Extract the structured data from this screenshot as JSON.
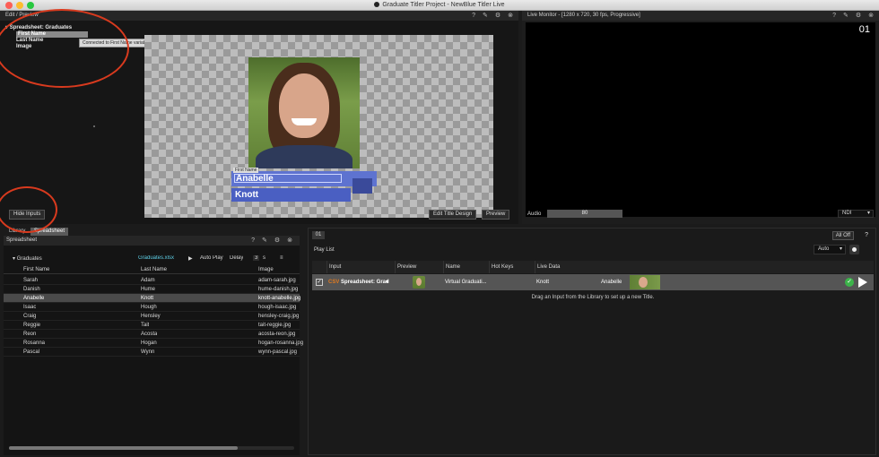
{
  "app": {
    "title": "Graduate Titler Project - NewBlue Titler Live"
  },
  "edit_panel": {
    "header": "Edit / Preview",
    "tree": {
      "root": "Spreadsheet: Graduates",
      "items": [
        "First Name",
        "Last Name",
        "Image"
      ],
      "selected": "First Name"
    },
    "tooltip": "Connected to First Name variable",
    "title_label": "First Name",
    "first_name_value": "Anabelle",
    "last_name_value": "Knott",
    "hide_inputs_label": "Hide Inputs",
    "edit_title_design_label": "Edit Title Design",
    "preview_label": "Preview",
    "icons": [
      "help-icon",
      "pen-icon",
      "gear-icon",
      "close-icon"
    ]
  },
  "monitor": {
    "header": "Live Monitor - [1280 x 720, 30 fps, Progressive]",
    "channel": "01",
    "audio_label": "Audio",
    "audio_value": "80",
    "output": "NDI"
  },
  "library": {
    "tabs": [
      "Library",
      "Spreadsheet"
    ],
    "active_tab": "Spreadsheet",
    "header": "Spreadsheet",
    "group": "Graduates",
    "file": "Graduates.xlsx",
    "auto_play_label": "Auto Play",
    "delay_label": "Delay",
    "delay_value": "3",
    "delay_unit": "s",
    "columns": [
      "First Name",
      "Last Name",
      "Image"
    ],
    "rows": [
      [
        "Sarah",
        "Adam",
        "adam-sarah.jpg"
      ],
      [
        "Danish",
        "Hume",
        "hume-danish.jpg"
      ],
      [
        "Anabelle",
        "Knott",
        "knott-anabelle.jpg"
      ],
      [
        "Isaac",
        "Hough",
        "hough-isaac.jpg"
      ],
      [
        "Craig",
        "Hensley",
        "hensley-craig.jpg"
      ],
      [
        "Reggie",
        "Tait",
        "tait-reggie.jpg"
      ],
      [
        "Reon",
        "Acosta",
        "acosta-reon.jpg"
      ],
      [
        "Rosanna",
        "Hogan",
        "hogan-rosanna.jpg"
      ],
      [
        "Pascal",
        "Wynn",
        "wynn-pascal.jpg"
      ]
    ],
    "selected_row": 2
  },
  "playlist": {
    "tab": "01",
    "all_off_label": "All Off",
    "help": "?",
    "title": "Play List",
    "mode": "Auto",
    "columns": [
      "Input",
      "Preview",
      "Name",
      "Hot Keys",
      "Live Data"
    ],
    "row": {
      "input_badge": "CSV",
      "input": "Spreadsheet: Grad",
      "name": "Virtual Graduati...",
      "hot_keys": "",
      "live_data_last": "Knott",
      "live_data_first": "Anabelle"
    },
    "drag_hint": "Drag an Input from the Library to set up a new Title."
  }
}
